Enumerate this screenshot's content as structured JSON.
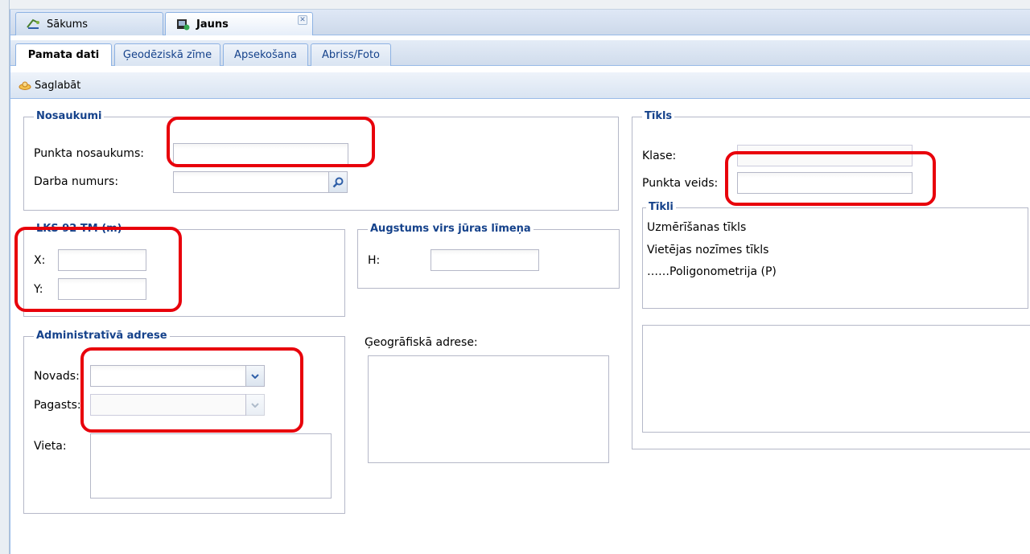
{
  "tabs": [
    {
      "label": "Sākums",
      "icon": "home-icon",
      "active": false
    },
    {
      "label": "Jauns",
      "icon": "new-doc-icon",
      "active": true
    }
  ],
  "subtabs": [
    "Pamata dati",
    "Ģeodēziskā zīme",
    "Apsekošana",
    "Abriss/Foto"
  ],
  "toolbar": {
    "save_label": "Saglabāt"
  },
  "nosaukumi": {
    "legend": "Nosaukumi",
    "punkta_nosaukums_label": "Punkta nosaukums:",
    "punkta_nosaukums_value": "",
    "darba_numurs_label": "Darba numurs:",
    "darba_numurs_value": ""
  },
  "lks": {
    "legend": "LKS 92 TM (m)",
    "x_label": "X:",
    "y_label": "Y:",
    "x_value": "",
    "y_value": ""
  },
  "augstums": {
    "legend": "Augstums virs jūras līmeņa",
    "h_label": "H:",
    "h_value": ""
  },
  "admin": {
    "legend": "Administratīvā adrese",
    "novads_label": "Novads:",
    "pagasts_label": "Pagasts:",
    "vieta_label": "Vieta:"
  },
  "geo_adrese_label": "Ģeogrāfiskā adrese:",
  "tikls": {
    "legend": "Tīkls",
    "klase_label": "Klase:",
    "punkta_veids_label": "Punkta veids:",
    "tikli_legend": "Tīkli",
    "tikli_items": [
      "Uzmērīšanas tīkls",
      "Vietējas nozīmes tīkls",
      "……Poligonometrija (P)"
    ]
  },
  "colors": {
    "highlight": "#e8000b",
    "legend": "#15428b",
    "border": "#99bbe8"
  }
}
